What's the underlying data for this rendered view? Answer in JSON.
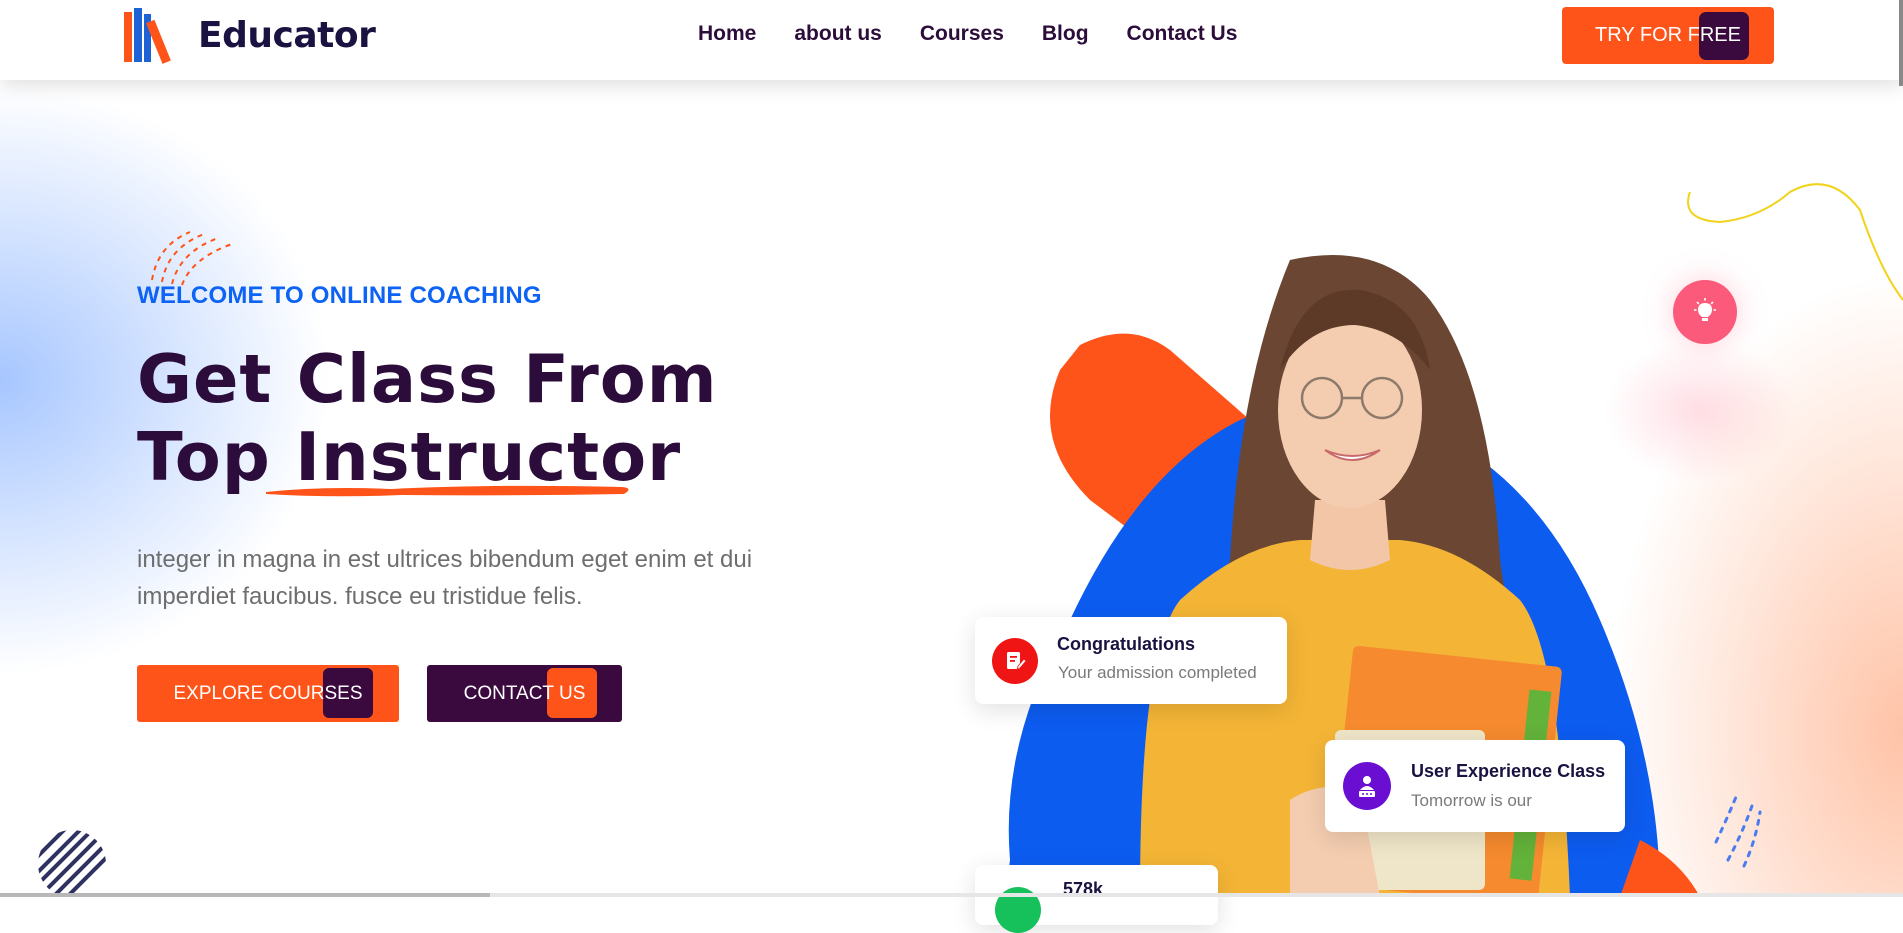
{
  "brand": {
    "name": "Educator"
  },
  "nav": {
    "items": [
      "Home",
      "about us",
      "Courses",
      "Blog",
      "Contact Us"
    ]
  },
  "header": {
    "cta_label": "TRY FOR FREE"
  },
  "hero": {
    "eyebrow": "WELCOME TO ONLINE COACHING",
    "title_line1": "Get Class From",
    "title_line2": "Top Instructor",
    "description": "integer in magna in est ultrices bibendum eget enim et dui imperdiet faucibus. fusce eu tristidue felis.",
    "explore_label": "EXPLORE COURSES",
    "contact_label": "CONTACT US"
  },
  "cards": [
    {
      "title": "Congratulations",
      "subtitle": "Your admission completed",
      "icon": "document-edit-icon",
      "color": "#f01515"
    },
    {
      "title": "User Experience Class",
      "subtitle": "Tomorrow is our",
      "icon": "user-award-icon",
      "color": "#6a0fd1"
    },
    {
      "title": "578k",
      "icon": "stats-icon",
      "color": "#16c05a"
    }
  ],
  "colors": {
    "accent": "#ff5419",
    "primary_dark": "#3a0a3f",
    "blue": "#0d63f3",
    "heading": "#2b0c3a"
  }
}
